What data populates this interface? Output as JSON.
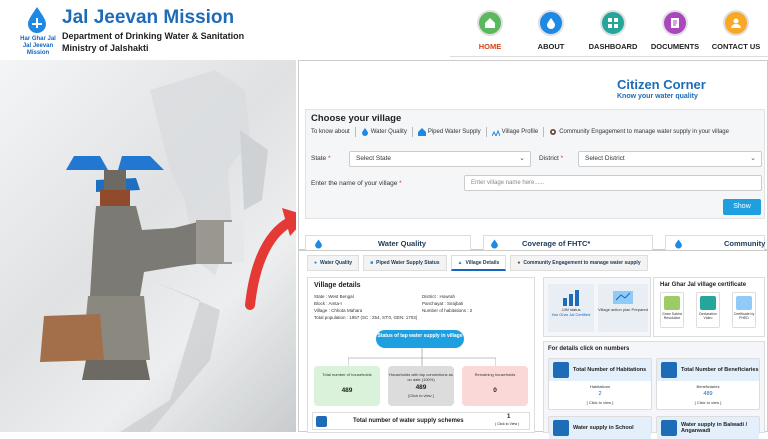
{
  "header": {
    "logo_text": "Har Ghar Jal\nJal Jeevan Mission",
    "title": "Jal Jeevan Mission",
    "department": "Department of Drinking Water & Sanitation",
    "ministry": "Ministry of Jalshakti",
    "nav": [
      {
        "label": "HOME",
        "icon": "home-icon",
        "color": "#5cb85c"
      },
      {
        "label": "ABOUT",
        "icon": "water-drop-icon",
        "color": "#1e88e5"
      },
      {
        "label": "DASHBOARD",
        "icon": "dashboard-icon",
        "color": "#26a69a"
      },
      {
        "label": "DOCUMENTS",
        "icon": "document-icon",
        "color": "#ab47bc"
      },
      {
        "label": "CONTACT US",
        "icon": "contact-icon",
        "color": "#f9a825"
      }
    ]
  },
  "citizen": {
    "title": "Citizen Corner",
    "subtitle": "Know your water quality",
    "choose_title": "Choose your village",
    "to_know": "To know about",
    "chips": [
      "Water Quality",
      "Piped Water Supply",
      "Village Profile",
      "Community Engagement to manage water supply in your village"
    ],
    "state_label": "State",
    "state_value": "Select State",
    "district_label": "District",
    "district_value": "Select District",
    "village_label": "Enter the name of your village",
    "village_placeholder": "Enter village name here......",
    "show_label": "Show",
    "bottom_cards": [
      "Water Quality",
      "Coverage of FHTC*",
      "Community"
    ]
  },
  "village": {
    "tabs": [
      "Water Quality",
      "Piped Water Supply Status",
      "Village Details",
      "Community Engagement to manage water supply"
    ],
    "details_title": "Village details",
    "state": "State : West Bengal",
    "district": "District : Howrah",
    "block": "Block : Amta-I",
    "panchayat": "Panchayat : Sirajbati",
    "village_name": "Village : Chhota Mahara",
    "habitations": "Number of habitations : 2",
    "population": "Total population : 1957 (SC : 254, ST:0, GEN: 1703)",
    "status_pill": "Status of tap water supply in village",
    "stats": [
      {
        "label": "Total number of households",
        "value": "489",
        "sub": ""
      },
      {
        "label": "Households with tap connections as on date (100%)",
        "value": "489",
        "sub": "[Click to view ]"
      },
      {
        "label": "Remaining households",
        "value": "0",
        "sub": ""
      }
    ],
    "schemes_label": "Total number of water supply schemes",
    "schemes_value": "1",
    "schemes_sub": "( Click to View )",
    "jjm_status": "JJM status",
    "jjm_certified": "Har Ghar Jal Certified",
    "action_plan": "Village action plan Prepared",
    "cert_title": "Har Ghar Jal village certificate",
    "cert_items": [
      "Gram Sabha Resolution",
      "Declaration Video",
      "Certificate by PHED"
    ],
    "details_click": "For details click on numbers",
    "habitations_card": {
      "title": "Total Number of Habitations",
      "label": "Habitations",
      "value": "2",
      "sub": "[ Click to view ]"
    },
    "beneficiaries_card": {
      "title": "Total Number of Beneficiaries",
      "label": "Beneficiaries",
      "value": "489",
      "sub": "[ Click to view ]"
    },
    "school_card": "Water supply in School",
    "balwadi_card": "Water supply in Balwadi / Anganwadi"
  }
}
